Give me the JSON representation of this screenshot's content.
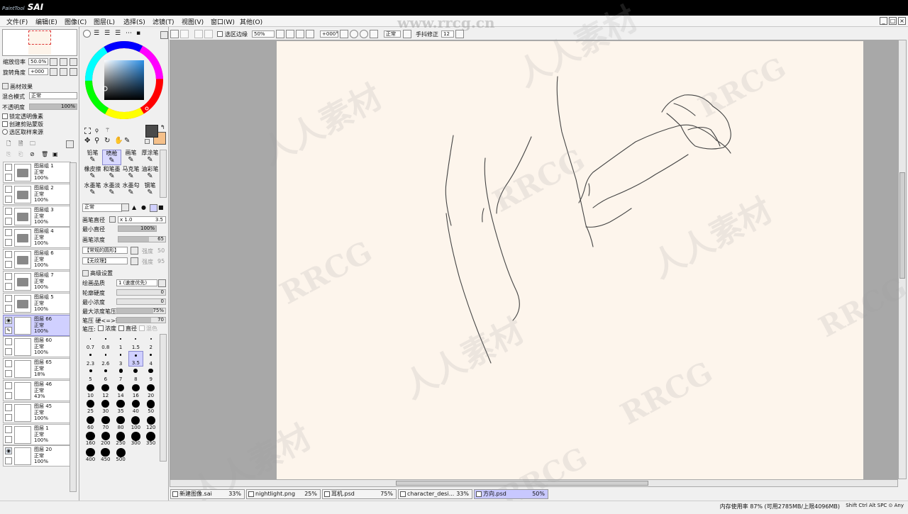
{
  "app": {
    "logo_main": "SAI",
    "logo_small": "PaintTool"
  },
  "watermark": {
    "site": "www.rrcg.cn",
    "brand": "RRCG",
    "cn_text": "人人素材"
  },
  "menu": [
    "文件(F)",
    "编辑(E)",
    "图像(C)",
    "图层(L)",
    "选择(S)",
    "滤镜(T)",
    "视图(V)",
    "窗口(W)",
    "其他(O)"
  ],
  "navigator": {
    "zoom_label": "缩放倍率",
    "zoom_value": "50.0%",
    "angle_label": "旋转角度",
    "angle_value": "+000"
  },
  "layer_panel": {
    "effect_label": "画材效果",
    "blend_label": "混合模式",
    "blend_value": "正常",
    "opacity_label": "不透明度",
    "opacity_value": "100%",
    "opacity_level": 1.0,
    "checks": [
      "锁定透明像素",
      "创建剪贴蒙版",
      "选区取样来源"
    ],
    "layers": [
      {
        "name": "图层组 1",
        "mode": "正常",
        "opacity": "100%",
        "type": "folder",
        "visible": false,
        "selected": false
      },
      {
        "name": "图层组 2",
        "mode": "正常",
        "opacity": "100%",
        "type": "folder",
        "visible": false,
        "selected": false
      },
      {
        "name": "图层组 3",
        "mode": "正常",
        "opacity": "100%",
        "type": "folder",
        "visible": false,
        "selected": false
      },
      {
        "name": "图层组 4",
        "mode": "正常",
        "opacity": "100%",
        "type": "folder",
        "visible": false,
        "selected": false
      },
      {
        "name": "图层组 6",
        "mode": "正常",
        "opacity": "100%",
        "type": "folder",
        "visible": false,
        "selected": false
      },
      {
        "name": "图层组 7",
        "mode": "正常",
        "opacity": "100%",
        "type": "folder",
        "visible": false,
        "selected": false
      },
      {
        "name": "图层组 5",
        "mode": "正常",
        "opacity": "100%",
        "type": "folder",
        "visible": false,
        "selected": false
      },
      {
        "name": "图层 66",
        "mode": "正常",
        "opacity": "100%",
        "type": "layer",
        "visible": true,
        "selected": true
      },
      {
        "name": "图层 60",
        "mode": "正常",
        "opacity": "100%",
        "type": "layer",
        "visible": false,
        "selected": false
      },
      {
        "name": "图层 65",
        "mode": "正常",
        "opacity": "18%",
        "type": "layer",
        "visible": false,
        "selected": false
      },
      {
        "name": "图层 46",
        "mode": "正常",
        "opacity": "43%",
        "type": "layer",
        "visible": false,
        "selected": false
      },
      {
        "name": "图层 45",
        "mode": "正常",
        "opacity": "100%",
        "type": "layer",
        "visible": false,
        "selected": false
      },
      {
        "name": "图层 1",
        "mode": "正常",
        "opacity": "100%",
        "type": "layer",
        "visible": false,
        "selected": false
      },
      {
        "name": "图层 20",
        "mode": "正常",
        "opacity": "100%",
        "type": "layer",
        "visible": true,
        "selected": false
      }
    ]
  },
  "tools": {
    "brushes": [
      "铅笔",
      "喷枪",
      "画笔",
      "厚涂笔",
      "橡皮擦",
      "和笔墨",
      "马克笔",
      "油彩笔",
      "水墨笔",
      "水墨淡",
      "水墨勾",
      "钢笔"
    ],
    "selected_brush": "喷枪",
    "blend_mode": "正常",
    "params": {
      "size_label": "画笔直径",
      "size_mult": "x 1.0",
      "size_value": "3.5",
      "min_size_label": "最小直径",
      "min_size_value": "100%",
      "min_size_level": 1.0,
      "density_label": "画笔浓度",
      "density_value": "65",
      "density_level": 0.65,
      "shape_value": "【常规的圆形】",
      "shape_strength": "强度",
      "shape_strength_value": "50",
      "texture_value": "【无纹理】",
      "texture_strength": "强度",
      "texture_strength_value": "95",
      "advanced_label": "高级设置",
      "quality_label": "绘画品质",
      "quality_value": "1 (速度优先)",
      "edge_label": "轮廓硬度",
      "edge_value": "0",
      "min_density_label": "最小浓度",
      "min_density_value": "0",
      "max_pressure_label": "最大浓度笔压",
      "max_pressure_value": "75%",
      "max_pressure_level": 0.75,
      "pressure_label": "笔压 硬<=>软",
      "pressure_value": "70",
      "pressure_level": 0.7,
      "pressure2_label": "笔压:",
      "check_density": "浓度",
      "check_size": "直径",
      "check_blend": "混色"
    },
    "sizes": [
      "0.7",
      "0.8",
      "1",
      "1.5",
      "2",
      "2.3",
      "2.6",
      "3",
      "3.5",
      "4",
      "5",
      "6",
      "7",
      "8",
      "9",
      "10",
      "12",
      "14",
      "16",
      "20",
      "25",
      "30",
      "35",
      "40",
      "50",
      "60",
      "70",
      "80",
      "100",
      "120",
      "160",
      "200",
      "250",
      "300",
      "350",
      "400",
      "450",
      "500"
    ],
    "selected_size": "3.5"
  },
  "toolbar": {
    "antialias_label": "选区边缘",
    "zoom_value": "50%",
    "angle_value": "+000°",
    "mode_value": "正常",
    "stabilizer_label": "手抖修正",
    "stabilizer_value": "12"
  },
  "tabs": [
    {
      "name": "新建图像.sai",
      "zoom": "33%",
      "selected": false
    },
    {
      "name": "nightlight.png",
      "zoom": "25%",
      "selected": false
    },
    {
      "name": "耳机.psd",
      "zoom": "75%",
      "selected": false
    },
    {
      "name": "character_desi...",
      "zoom": "33%",
      "selected": false
    },
    {
      "name": "方向.psd",
      "zoom": "50%",
      "selected": true
    }
  ],
  "status": {
    "memory": "内存使用率 87% (可用2785MB/上限4096MB)",
    "keys": "Shift Ctrl Alt SPC ⊙ Any"
  },
  "colors": {
    "primary": "#4a4a4a",
    "secondary": "#f5c08a",
    "paper": "#fdf5ec",
    "selection": "#d0d0ff"
  }
}
